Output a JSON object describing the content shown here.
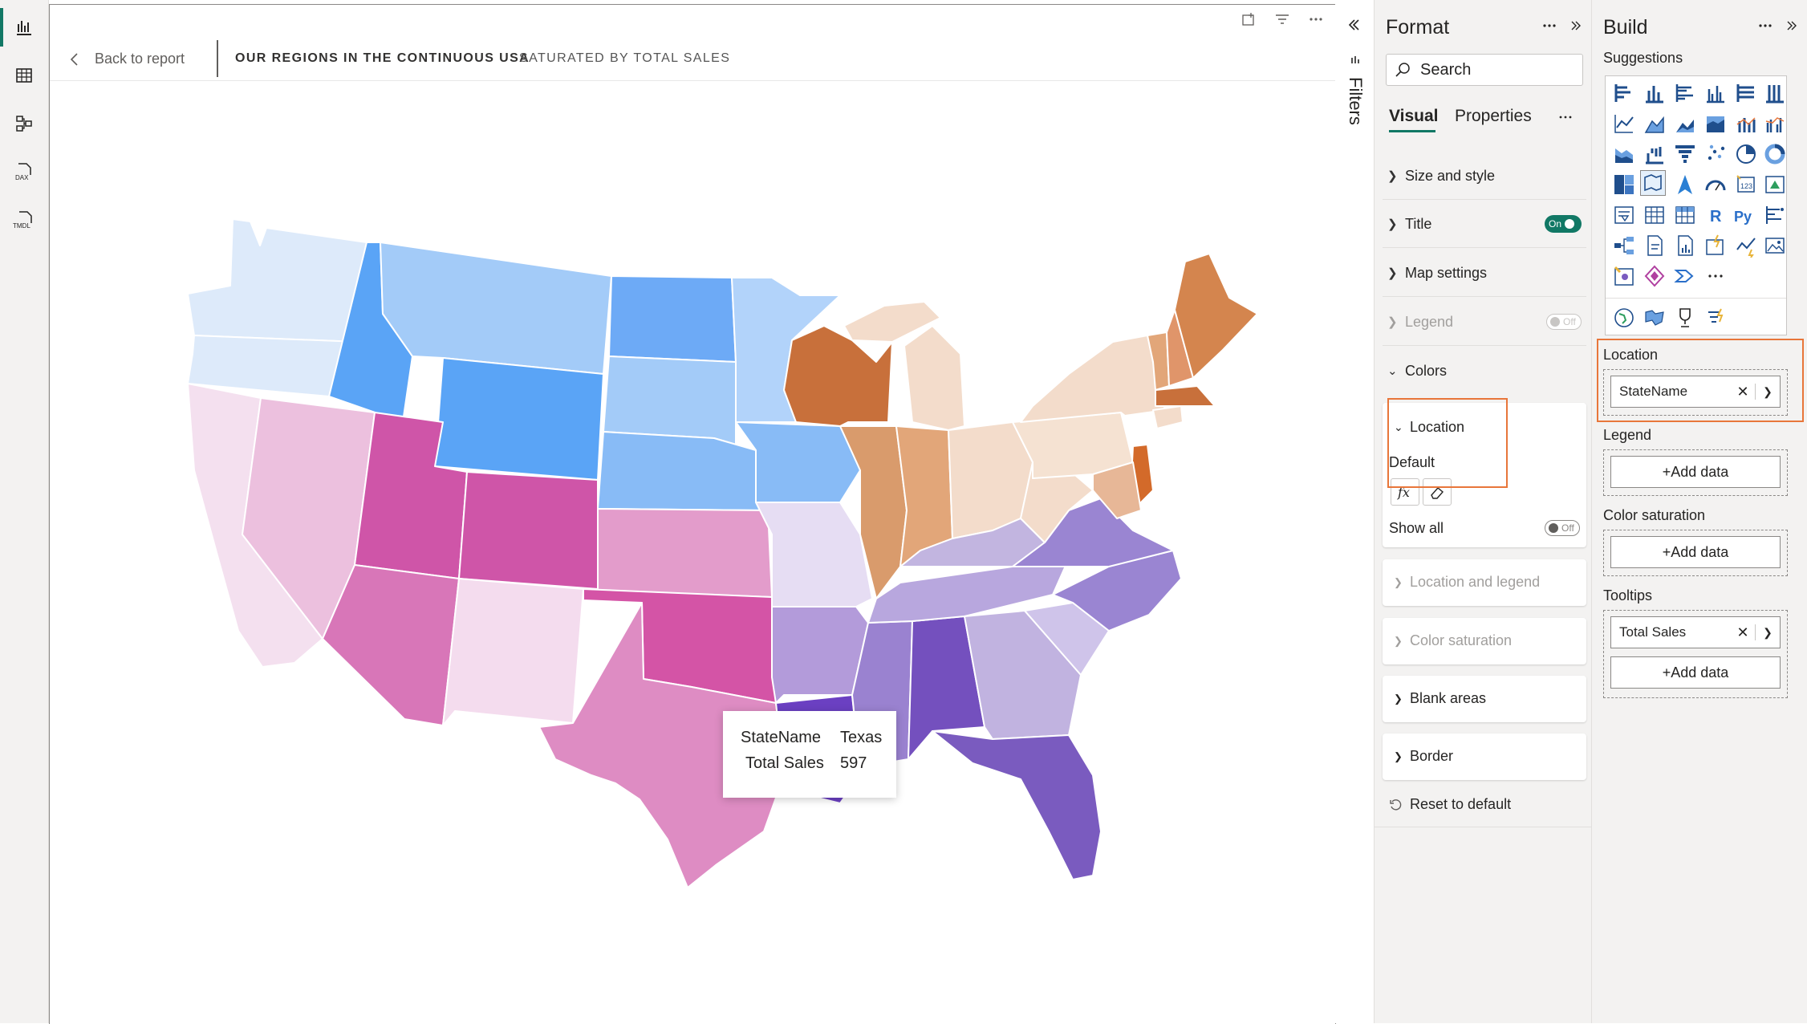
{
  "report": {
    "back_label": "Back to report",
    "title": "OUR REGIONS IN THE CONTINUOUS USA",
    "subtitle": "SATURATED BY TOTAL SALES"
  },
  "tooltip": {
    "row1_key": "StateName",
    "row1_val": "Texas",
    "row2_key": "Total Sales",
    "row2_val": "597"
  },
  "filters": {
    "label": "Filters"
  },
  "format": {
    "title": "Format",
    "search_placeholder": "Search",
    "tabs": [
      "Visual",
      "Properties"
    ],
    "sections": {
      "size": "Size and style",
      "title": "Title",
      "title_toggle": "On",
      "map": "Map settings",
      "legend": "Legend",
      "legend_toggle": "Off",
      "colors": "Colors",
      "location": "Location",
      "default": "Default",
      "show_all": "Show all",
      "show_all_toggle": "Off",
      "loc_legend": "Location and legend",
      "color_sat": "Color saturation",
      "blank": "Blank areas",
      "border": "Border",
      "reset": "Reset to default"
    }
  },
  "build": {
    "title": "Build",
    "suggestions": "Suggestions",
    "location_label": "Location",
    "location_field": "StateName",
    "legend_label": "Legend",
    "color_sat_label": "Color saturation",
    "tooltips_label": "Tooltips",
    "tooltip_field": "Total Sales",
    "add_data": "+Add data"
  },
  "colors": {
    "accent": "#117865",
    "highlight": "#e8763a",
    "region_west_light": "#ddeafa",
    "region_blue": "#5aa4f6",
    "region_pink": "#d876b8",
    "region_orange": "#c8703b",
    "region_purple": "#7a5bbf"
  }
}
